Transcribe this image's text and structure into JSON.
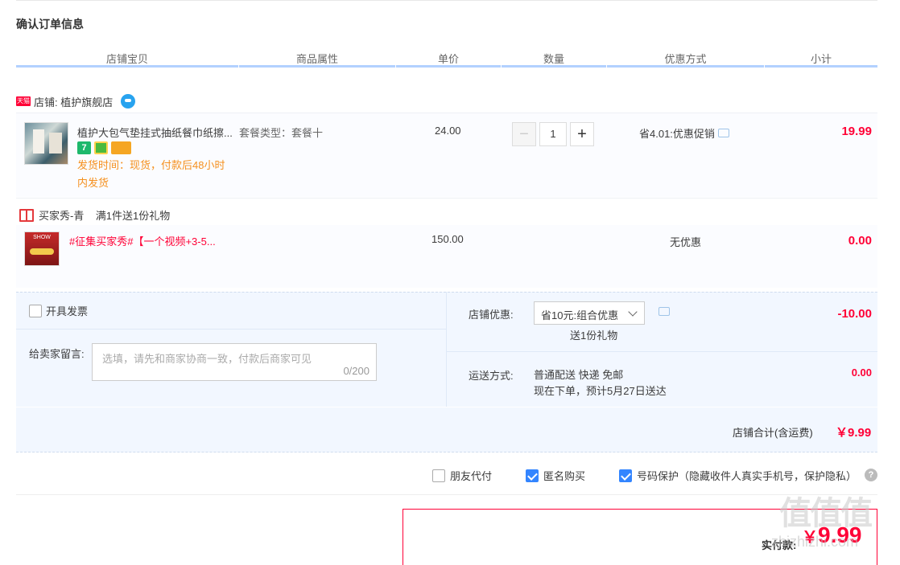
{
  "page_title": "确认订单信息",
  "columns": [
    "店铺宝贝",
    "商品属性",
    "单价",
    "数量",
    "优惠方式",
    "小计"
  ],
  "shop": {
    "platform_badge": "天猫",
    "label": "店铺: 植护旗舰店"
  },
  "item": {
    "title": "植护大包气垫挂式抽纸餐巾纸擦...",
    "sku": "套餐类型：套餐十",
    "badges": [
      "7",
      "",
      ""
    ],
    "ship_time_line1": "发货时间：现货，付款后48小时",
    "ship_time_line2": "内发货",
    "price": "24.00",
    "quantity": "1",
    "qty_minus": "−",
    "qty_plus": "+",
    "discount": "省4.01:优惠促销",
    "subtotal": "19.99"
  },
  "gift": {
    "header": "买家秀-青    满1件送1份礼物",
    "thumb_text": "SHOW",
    "title": "#征集买家秀#【一个视频+3-5...",
    "price": "150.00",
    "discount": "无优惠",
    "subtotal": "0.00"
  },
  "options": {
    "invoice_label": "开具发票",
    "memo_label": "给卖家留言:",
    "memo_placeholder": "选填，请先和商家协商一致，付款后商家可见",
    "memo_count": "0/200",
    "shop_discount_label": "店铺优惠:",
    "shop_discount_selected": "省10元:组合优惠",
    "shop_discount_gift": "送1份礼物",
    "shop_discount_amount": "-10.00",
    "shipping_label": "运送方式:",
    "shipping_line1": "普通配送 快递 免邮",
    "shipping_line2": "现在下单，预计5月27日送达",
    "shipping_amount": "0.00"
  },
  "total": {
    "label": "店铺合计(含运费)",
    "amount": "￥9.99"
  },
  "extra_options": [
    {
      "label": "朋友代付",
      "checked": false
    },
    {
      "label": "匿名购买",
      "checked": true
    },
    {
      "label": "号码保护（隐藏收件人真实手机号，保护隐私）",
      "checked": true
    }
  ],
  "help_icon": "?",
  "pay": {
    "label": "实付款:",
    "yen": "￥",
    "amount": "9.99"
  },
  "watermark": {
    "logo": "值值值",
    "site": "zhizhizhi.com"
  },
  "colors": {
    "accent_red": "#ff0036",
    "column_line": "#b2d1ff",
    "panel_bg": "#f2f7ff",
    "checkbox_blue": "#3385ff",
    "ship_orange": "#f5901e"
  }
}
